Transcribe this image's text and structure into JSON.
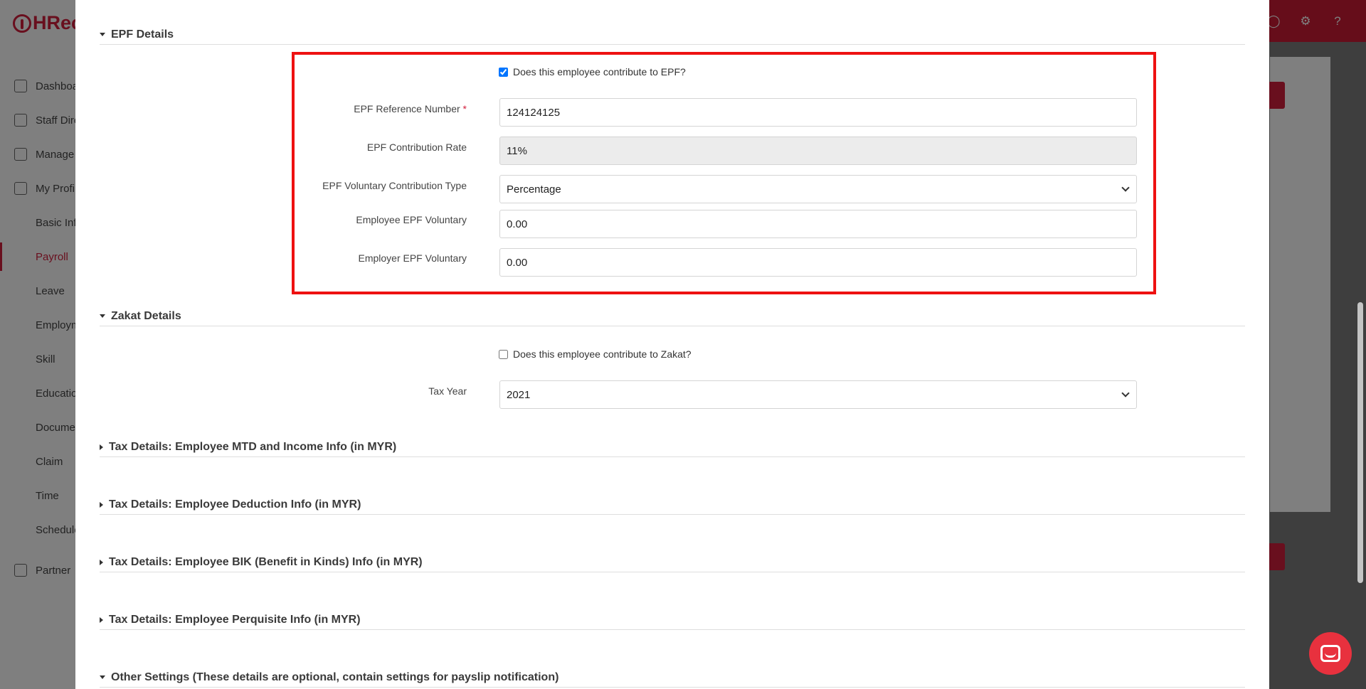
{
  "app": {
    "logo_text": "HRec"
  },
  "sidebar": {
    "items": [
      {
        "label": "Dashboard",
        "icon": "chart-icon"
      },
      {
        "label": "Staff Directory",
        "icon": "badge-icon"
      },
      {
        "label": "Manage",
        "icon": "building-icon"
      },
      {
        "label": "My Profile",
        "icon": "user-icon"
      },
      {
        "label": "Basic Info"
      },
      {
        "label": "Payroll"
      },
      {
        "label": "Leave"
      },
      {
        "label": "Employment"
      },
      {
        "label": "Skill"
      },
      {
        "label": "Education"
      },
      {
        "label": "Documents"
      },
      {
        "label": "Claim"
      },
      {
        "label": "Time"
      },
      {
        "label": "Schedule"
      },
      {
        "label": "Partner",
        "icon": "partner-icon"
      }
    ]
  },
  "modal": {
    "epf": {
      "title": "EPF Details",
      "contribute_label": "Does this employee contribute to EPF?",
      "contribute_checked": true,
      "ref_label": "EPF Reference Number",
      "ref_required": "*",
      "ref_value": "124124125",
      "rate_label": "EPF Contribution Rate",
      "rate_value": "11%",
      "vol_type_label": "EPF Voluntary Contribution Type",
      "vol_type_value": "Percentage",
      "employee_vol_label": "Employee EPF Voluntary",
      "employee_vol_value": "0.00",
      "employer_vol_label": "Employer EPF Voluntary",
      "employer_vol_value": "0.00"
    },
    "zakat": {
      "title": "Zakat Details",
      "contribute_label": "Does this employee contribute to Zakat?",
      "contribute_checked": false,
      "tax_year_label": "Tax Year",
      "tax_year_value": "2021"
    },
    "sections": [
      "Tax Details: Employee MTD and Income Info (in MYR)",
      "Tax Details: Employee Deduction Info (in MYR)",
      "Tax Details: Employee BIK (Benefit in Kinds) Info (in MYR)",
      "Tax Details: Employee Perquisite Info (in MYR)",
      "Other Settings (These details are optional, contain settings for payslip notification)"
    ]
  }
}
